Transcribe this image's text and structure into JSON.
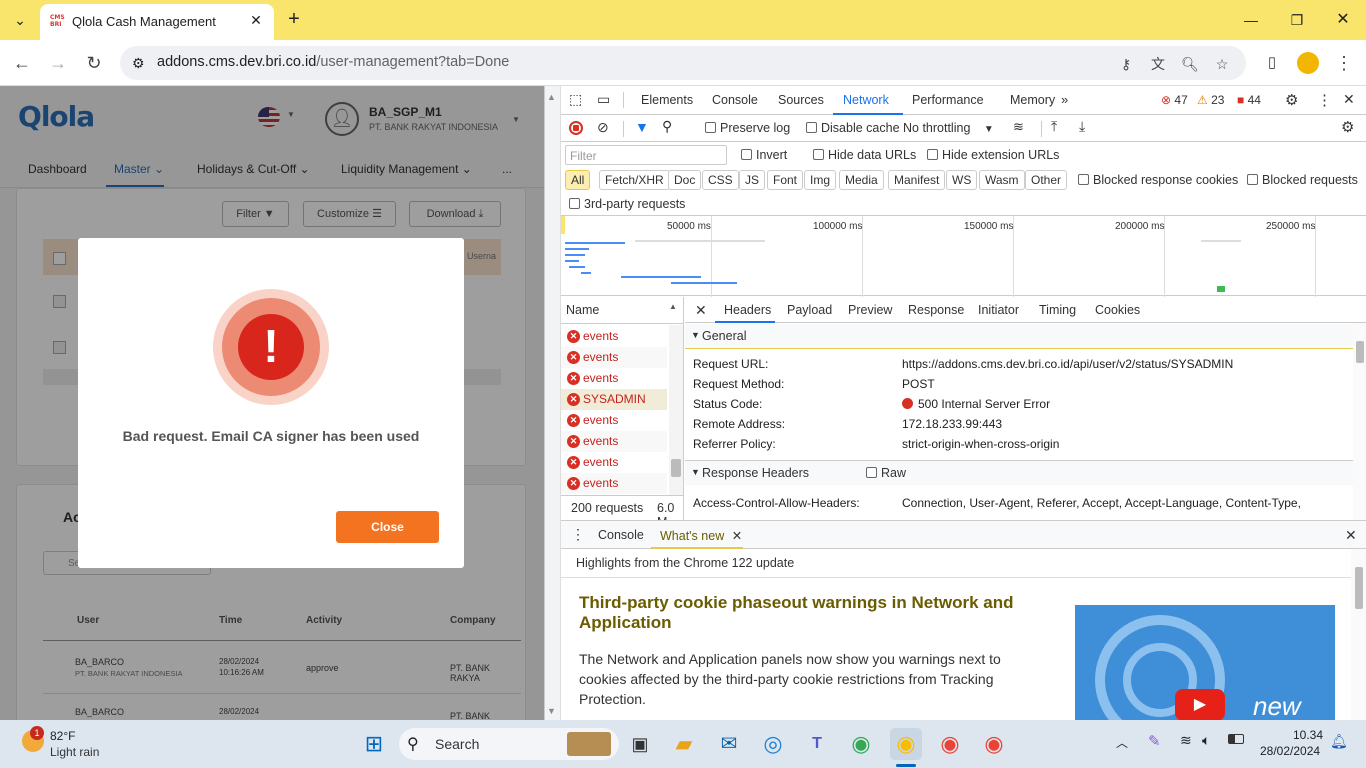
{
  "browser": {
    "tab_title": "Qlola Cash Management",
    "favicon_text": "CMS BRI",
    "url_host": "addons.cms.dev.bri.co.id",
    "url_path": "/user-management?tab=Done",
    "new_tab": "+",
    "tab_close": "✕"
  },
  "app": {
    "logo_q": "Q",
    "logo_rest": "lola",
    "user_name": "BA_SGP_M1",
    "user_company": "PT. BANK RAKYAT INDONESIA",
    "menu": [
      "Dashboard",
      "Master",
      "Holidays & Cut-Off",
      "Liquidity Management",
      "..."
    ],
    "toolbar": {
      "filter": "Filter",
      "customize": "Customize",
      "download": "Download"
    },
    "grid_header_partial": "Userna",
    "activity_title": "Ac",
    "search_placeholder": "Se",
    "activity_table": {
      "headers": [
        "User",
        "Time",
        "Activity",
        "Company"
      ],
      "rows": [
        {
          "user": "BA_BARCO",
          "sub": "PT. BANK RAKYAT INDONESIA",
          "date": "28/02/2024",
          "time": "10:16:26 AM",
          "activity": "approve",
          "company": "PT. BANK RAKYA"
        },
        {
          "user": "BA_BARCO",
          "sub": "",
          "date": "28/02/2024",
          "time": "",
          "activity": "",
          "company": "PT. BANK RAKYA"
        }
      ]
    }
  },
  "modal": {
    "icon": "!",
    "message": "Bad request. Email CA signer has been used",
    "close_label": "Close"
  },
  "devtools": {
    "tabs": [
      "Elements",
      "Console",
      "Sources",
      "Network",
      "Performance",
      "Memory"
    ],
    "errors": "47",
    "warnings": "23",
    "issues": "44",
    "network_toolbar": {
      "preserve_log": "Preserve log",
      "disable_cache": "Disable cache",
      "throttling": "No throttling"
    },
    "filter_placeholder": "Filter",
    "filter_opts": {
      "invert": "Invert",
      "hide_data": "Hide data URLs",
      "hide_ext": "Hide extension URLs"
    },
    "type_pills": [
      "All",
      "Fetch/XHR",
      "Doc",
      "CSS",
      "JS",
      "Font",
      "Img",
      "Media",
      "Manifest",
      "WS",
      "Wasm",
      "Other"
    ],
    "blocked_cookies": "Blocked response cookies",
    "blocked_requests": "Blocked requests",
    "third_party": "3rd-party requests",
    "overview_ticks": [
      "50000 ms",
      "100000 ms",
      "150000 ms",
      "200000 ms",
      "250000 ms"
    ],
    "name_header": "Name",
    "requests": [
      "events",
      "events",
      "events",
      "SYSADMIN",
      "events",
      "events",
      "events",
      "events"
    ],
    "summary_requests": "200 requests",
    "summary_size": "6.0 M",
    "detail_tabs": [
      "Headers",
      "Payload",
      "Preview",
      "Response",
      "Initiator",
      "Timing",
      "Cookies"
    ],
    "general_title": "General",
    "general": [
      {
        "k": "Request URL:",
        "v": "https://addons.cms.dev.bri.co.id/api/user/v2/status/SYSADMIN"
      },
      {
        "k": "Request Method:",
        "v": "POST"
      },
      {
        "k": "Status Code:",
        "v": "500 Internal Server Error"
      },
      {
        "k": "Remote Address:",
        "v": "172.18.233.99:443"
      },
      {
        "k": "Referrer Policy:",
        "v": "strict-origin-when-cross-origin"
      }
    ],
    "response_headers_title": "Response Headers",
    "raw_label": "Raw",
    "acah_key": "Access-Control-Allow-Headers:",
    "acah_val": "Connection, User-Agent, Referer, Accept, Accept-Language, Content-Type,",
    "drawer_tabs": [
      "Console",
      "What's new"
    ],
    "whatsnew_subtitle": "Highlights from the Chrome 122 update",
    "whatsnew_heading": "Third-party cookie phaseout warnings in Network and Application",
    "whatsnew_body": "The Network and Application panels now show you warnings next to cookies affected by the third-party cookie restrictions from Tracking Protection.",
    "video_label": "new"
  },
  "taskbar": {
    "temp": "82°F",
    "weather": "Light rain",
    "weather_badge": "1",
    "search": "Search",
    "time": "10.34",
    "date": "28/02/2024"
  }
}
